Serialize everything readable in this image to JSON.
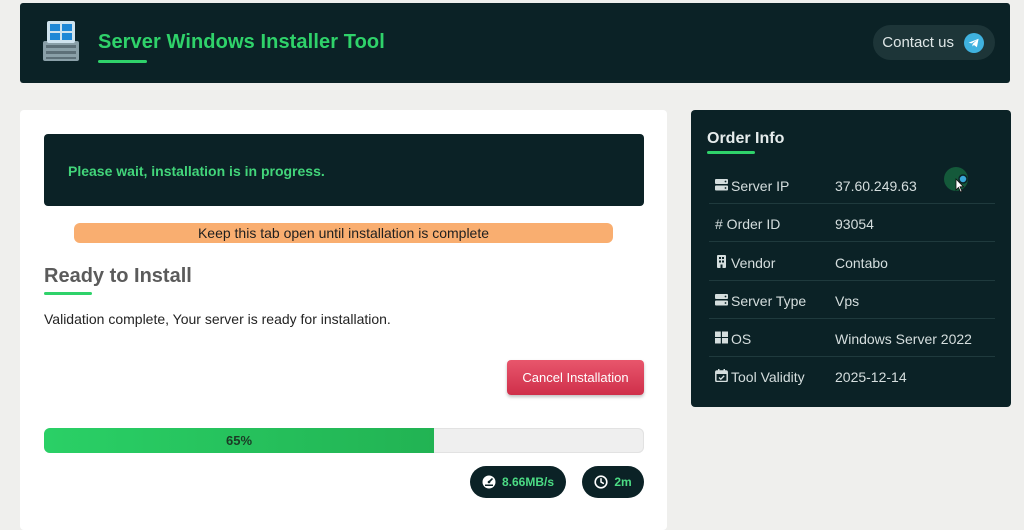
{
  "header": {
    "title": "Server Windows Installer Tool",
    "contact_label": "Contact us",
    "logo_icon": "windows-server-logo-icon",
    "contact_icon": "telegram-icon"
  },
  "main": {
    "banner_text": "Please wait, installation is in progress.",
    "warning_text": "Keep this tab open until installation is complete",
    "section_title": "Ready to Install",
    "status_text": "Validation complete, Your server is ready for installation.",
    "cancel_label": "Cancel Installation",
    "progress_value": 65,
    "progress_label": "65%",
    "speed_label": "8.66MB/s",
    "speed_icon": "speedometer-icon",
    "time_label": "2m",
    "time_icon": "clock-icon"
  },
  "order": {
    "title": "Order Info",
    "rows": [
      {
        "icon": "server-icon",
        "label": "Server IP",
        "value": "37.60.249.63"
      },
      {
        "icon": "hash-icon",
        "label": "# Order ID",
        "value": "93054"
      },
      {
        "icon": "building-icon",
        "label": "Vendor",
        "value": "Contabo"
      },
      {
        "icon": "server-icon",
        "label": "Server Type",
        "value": "Vps"
      },
      {
        "icon": "windows-icon",
        "label": "OS",
        "value": "Windows Server 2022"
      },
      {
        "icon": "calendar-check-icon",
        "label": "Tool Validity",
        "value": "2025-12-14"
      }
    ]
  },
  "colors": {
    "dark_panel": "#0b2226",
    "accent_green": "#2fd26a",
    "warning_orange": "#f9ae70",
    "danger_red": "#d9394f"
  }
}
